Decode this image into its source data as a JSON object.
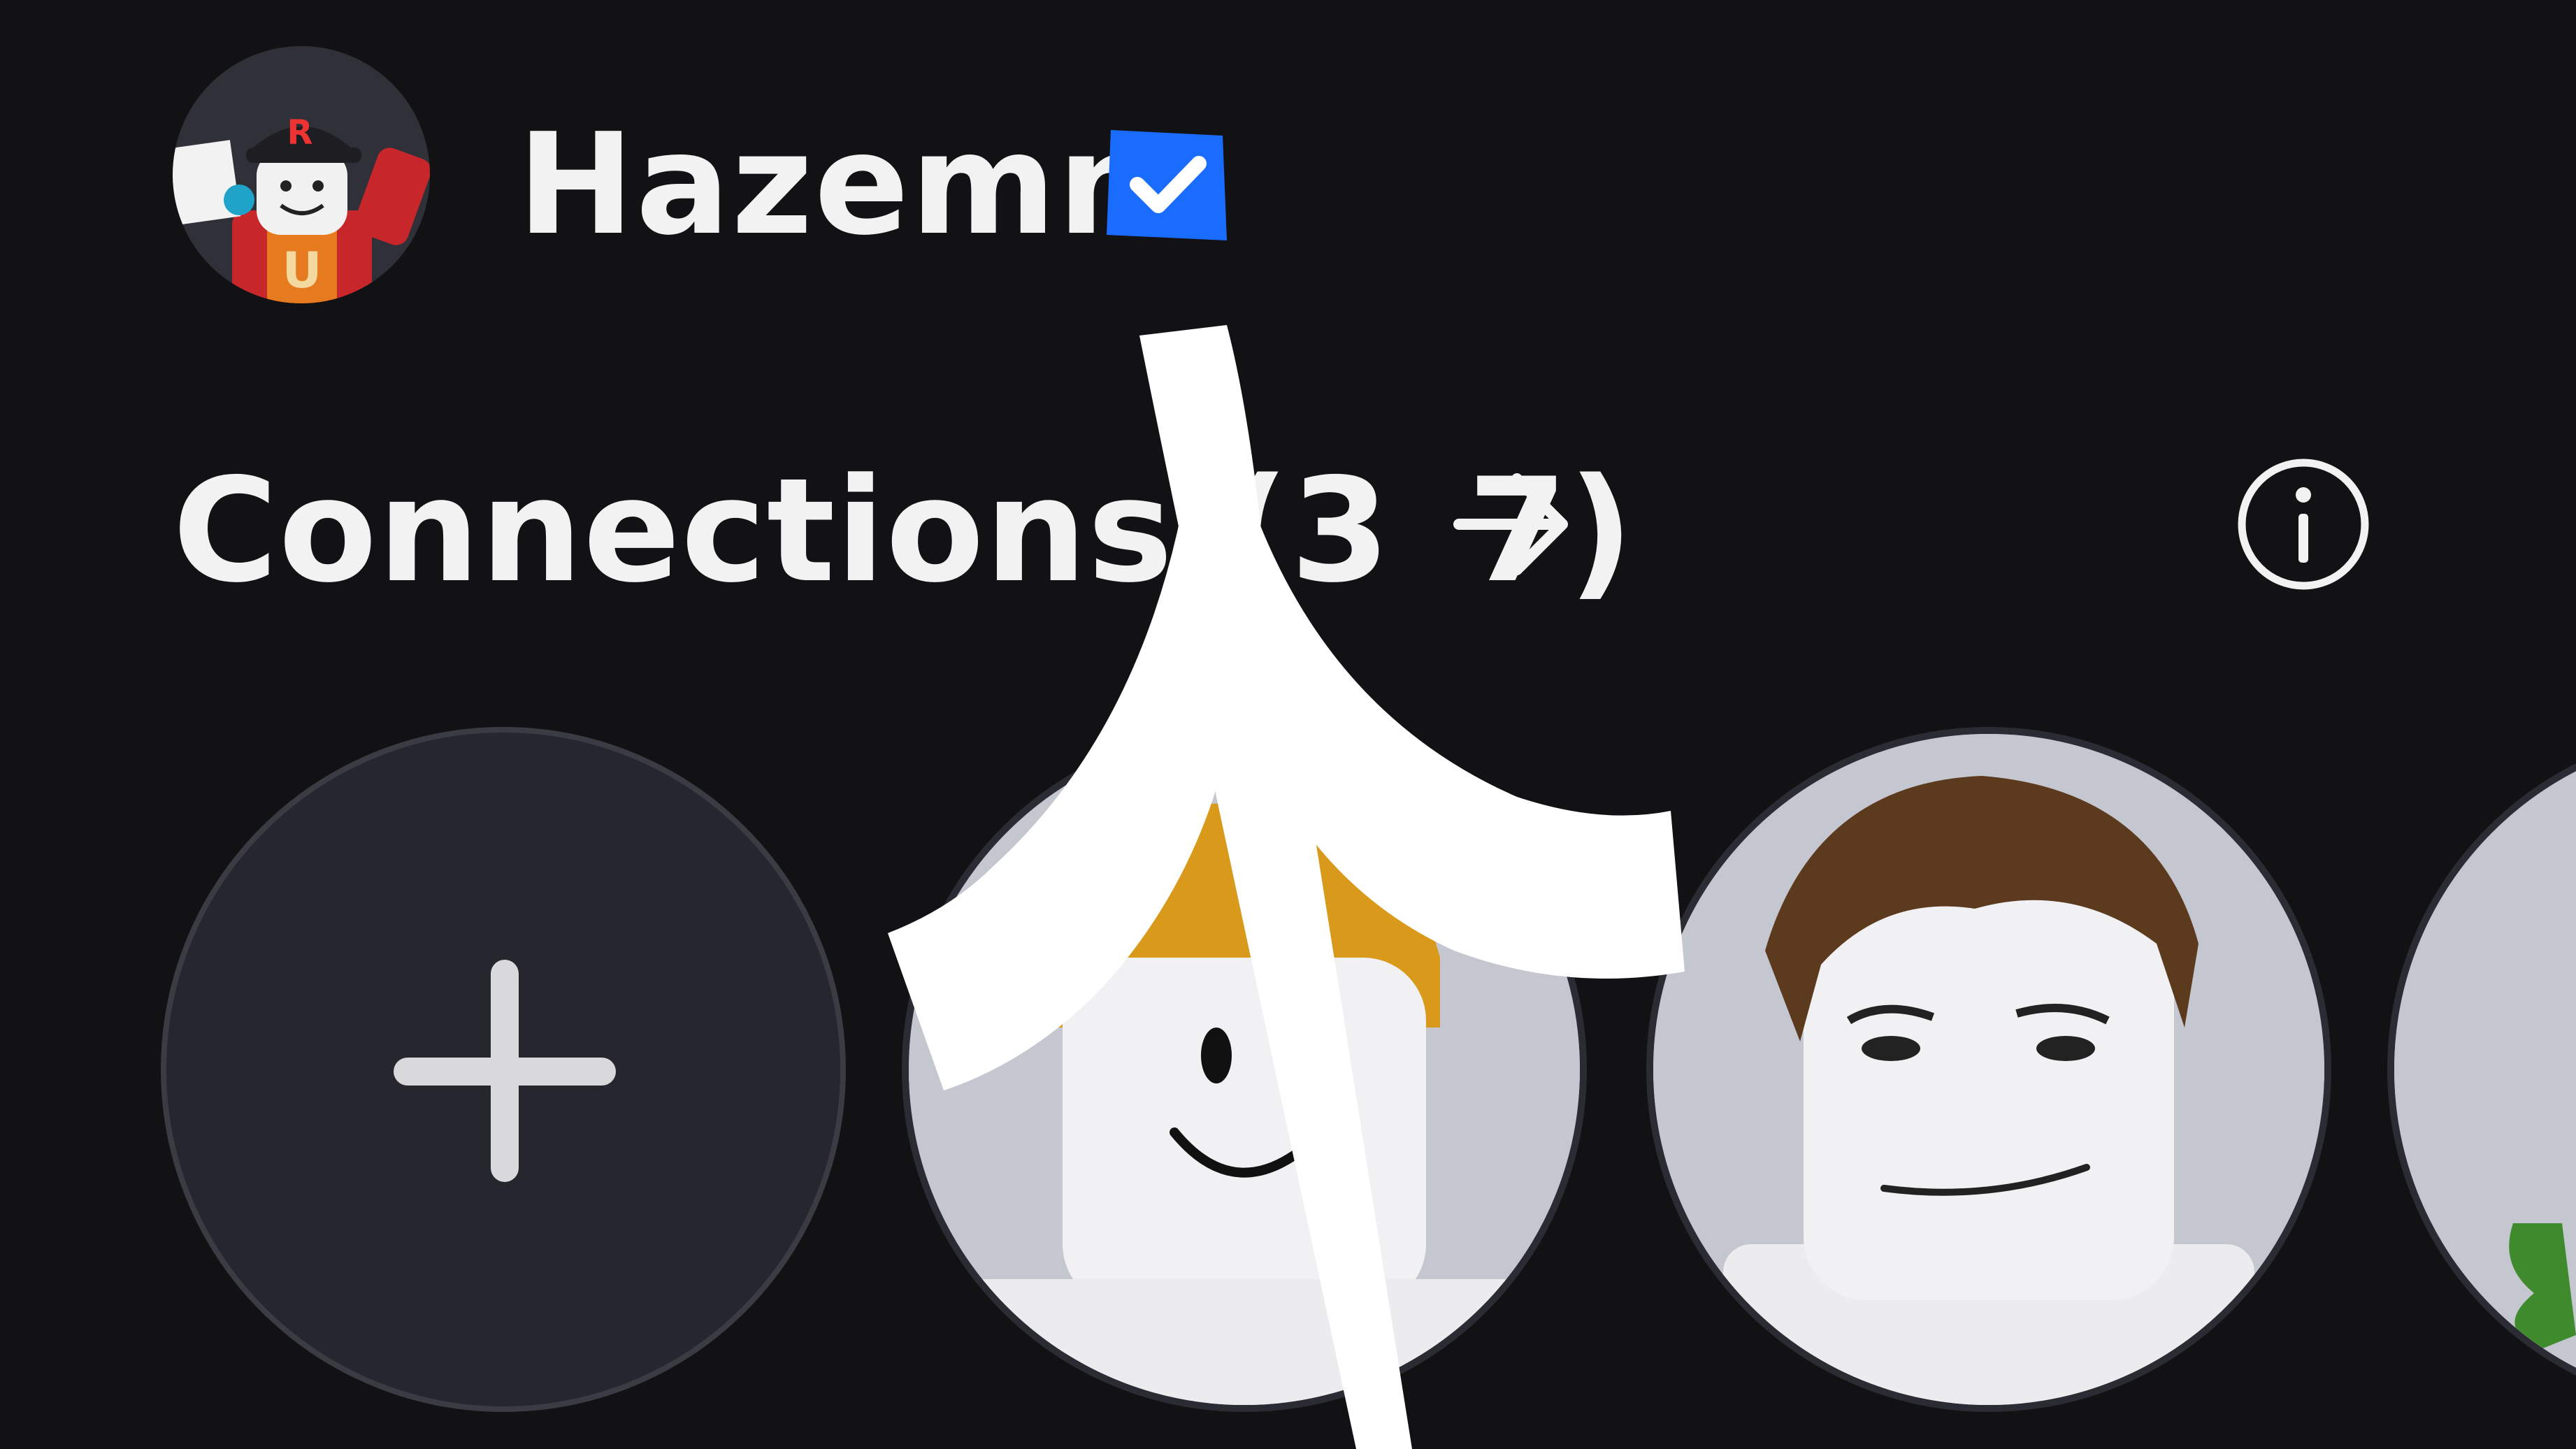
{
  "profile": {
    "username": "Hazemn",
    "verified": true,
    "avatar_icon": "avatar-icon"
  },
  "connections": {
    "title": "Connections (3",
    "title_rest": "7)",
    "arrow_icon": "arrow-right-icon",
    "info_icon": "info-icon"
  },
  "friends": {
    "add_icon": "plus-icon",
    "items": [
      {
        "avatar_icon": "friend-avatar-icon"
      },
      {
        "avatar_icon": "friend-avatar-icon"
      },
      {
        "avatar_icon": "friend-avatar-icon"
      }
    ]
  },
  "colors": {
    "background": "#121215",
    "text": "#f2f2f2",
    "verified": "#1a6cff",
    "tile_bg": "#26272e"
  }
}
